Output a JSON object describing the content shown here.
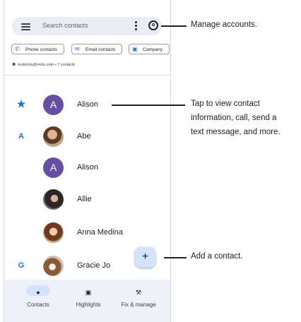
{
  "search": {
    "placeholder": "Search contacts"
  },
  "chips": [
    {
      "label": "Phone contacts",
      "icon": "phone-icon"
    },
    {
      "label": "Email contacts",
      "icon": "email-icon"
    },
    {
      "label": "Company",
      "icon": "company-icon"
    }
  ],
  "account_line": "motorola@moto.com • 7 contacts",
  "contacts": [
    {
      "index": "★",
      "name": "Alison",
      "avatar": "A"
    },
    {
      "index": "A",
      "name": "Abe",
      "avatar": ""
    },
    {
      "index": "",
      "name": "Alison",
      "avatar": "A"
    },
    {
      "index": "",
      "name": "Allie",
      "avatar": ""
    },
    {
      "index": "",
      "name": "Anna Medina",
      "avatar": ""
    },
    {
      "index": "G",
      "name": "Gracie Jo",
      "avatar": ""
    }
  ],
  "fab": {
    "label": "+"
  },
  "nav": [
    {
      "label": "Contacts",
      "icon": "person-icon",
      "active": true
    },
    {
      "label": "Highlights",
      "icon": "highlights-icon",
      "active": false
    },
    {
      "label": "Fix & manage",
      "icon": "wrench-icon",
      "active": false
    }
  ],
  "callouts": {
    "accounts": "Manage accounts.",
    "contact_line1": "Tap to view contact",
    "contact_line2": "information, call, send a",
    "contact_line3": "text message, and more.",
    "add": "Add a contact."
  },
  "colors": {
    "accent": "#1a73e8",
    "avatar_letter_bg": "#6750a4",
    "fab_bg": "#d3e3fd",
    "search_bg": "#e9eef6"
  }
}
